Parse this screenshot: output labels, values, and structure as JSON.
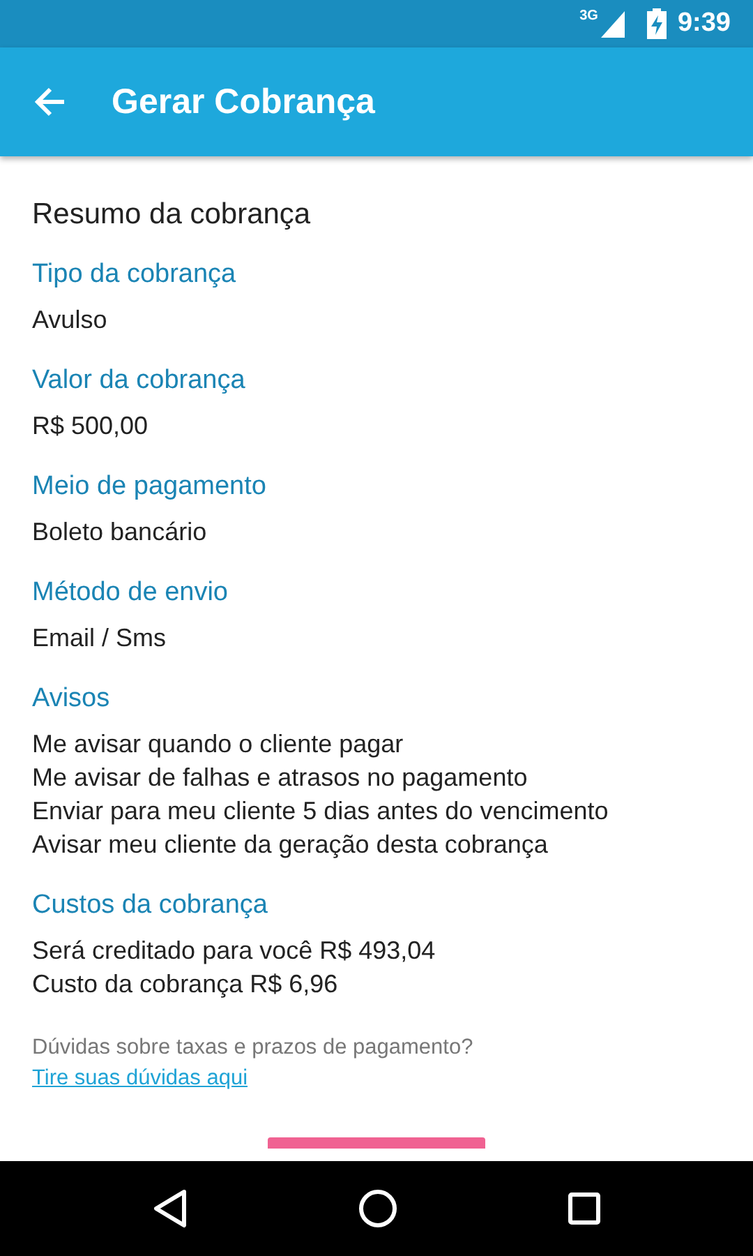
{
  "status_bar": {
    "network": "3G",
    "time": "9:39"
  },
  "app_bar": {
    "title": "Gerar Cobrança"
  },
  "heading": "Resumo da cobrança",
  "sections": [
    {
      "label": "Tipo da cobrança",
      "lines": [
        "Avulso"
      ]
    },
    {
      "label": "Valor da cobrança",
      "lines": [
        "R$ 500,00"
      ]
    },
    {
      "label": "Meio de pagamento",
      "lines": [
        "Boleto bancário"
      ]
    },
    {
      "label": "Método de envio",
      "lines": [
        "Email / Sms"
      ]
    },
    {
      "label": "Avisos",
      "lines": [
        "Me avisar quando o cliente pagar",
        "Me avisar de falhas e atrasos no pagamento",
        "Enviar para meu cliente 5 dias antes do vencimento",
        "Avisar meu cliente da geração desta cobrança"
      ]
    },
    {
      "label": "Custos da cobrança",
      "lines": [
        "Será creditado para você R$ 493,04",
        "Custo da cobrança R$ 6,96"
      ]
    }
  ],
  "help": {
    "question": "Dúvidas sobre taxas e prazos de pagamento?",
    "link": "Tire suas dúvidas aqui"
  }
}
